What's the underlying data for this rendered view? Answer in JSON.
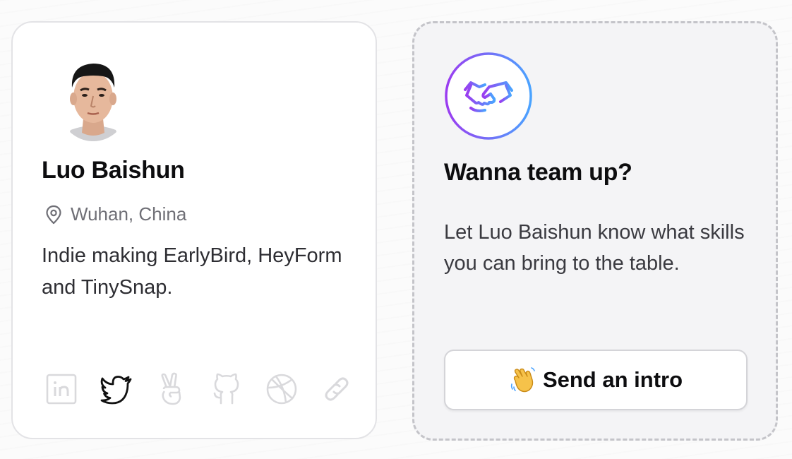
{
  "profile": {
    "name": "Luo Baishun",
    "location": "Wuhan, China",
    "bio": "Indie making EarlyBird, HeyForm and TinySnap.",
    "avatar_alt": "Luo Baishun",
    "socials": [
      {
        "icon": "linkedin-icon",
        "active": false
      },
      {
        "icon": "twitter-icon",
        "active": true
      },
      {
        "icon": "producthunt-hand-icon",
        "active": false
      },
      {
        "icon": "github-icon",
        "active": false
      },
      {
        "icon": "dribbble-icon",
        "active": false
      },
      {
        "icon": "link-icon",
        "active": false
      }
    ]
  },
  "team_up": {
    "icon": "handshake-icon",
    "title": "Wanna team up?",
    "description": "Let Luo Baishun know what skills you can bring to the table.",
    "button_label": "Send an intro",
    "button_icon": "waving-hand-icon"
  },
  "colors": {
    "icon_active": "#111111",
    "icon_inactive": "#d9d9dc",
    "gradient_start": "#9b3cf0",
    "gradient_end": "#4aa3ff",
    "card_border": "#e3e3e6",
    "dashed_border": "#c4c4c9"
  }
}
